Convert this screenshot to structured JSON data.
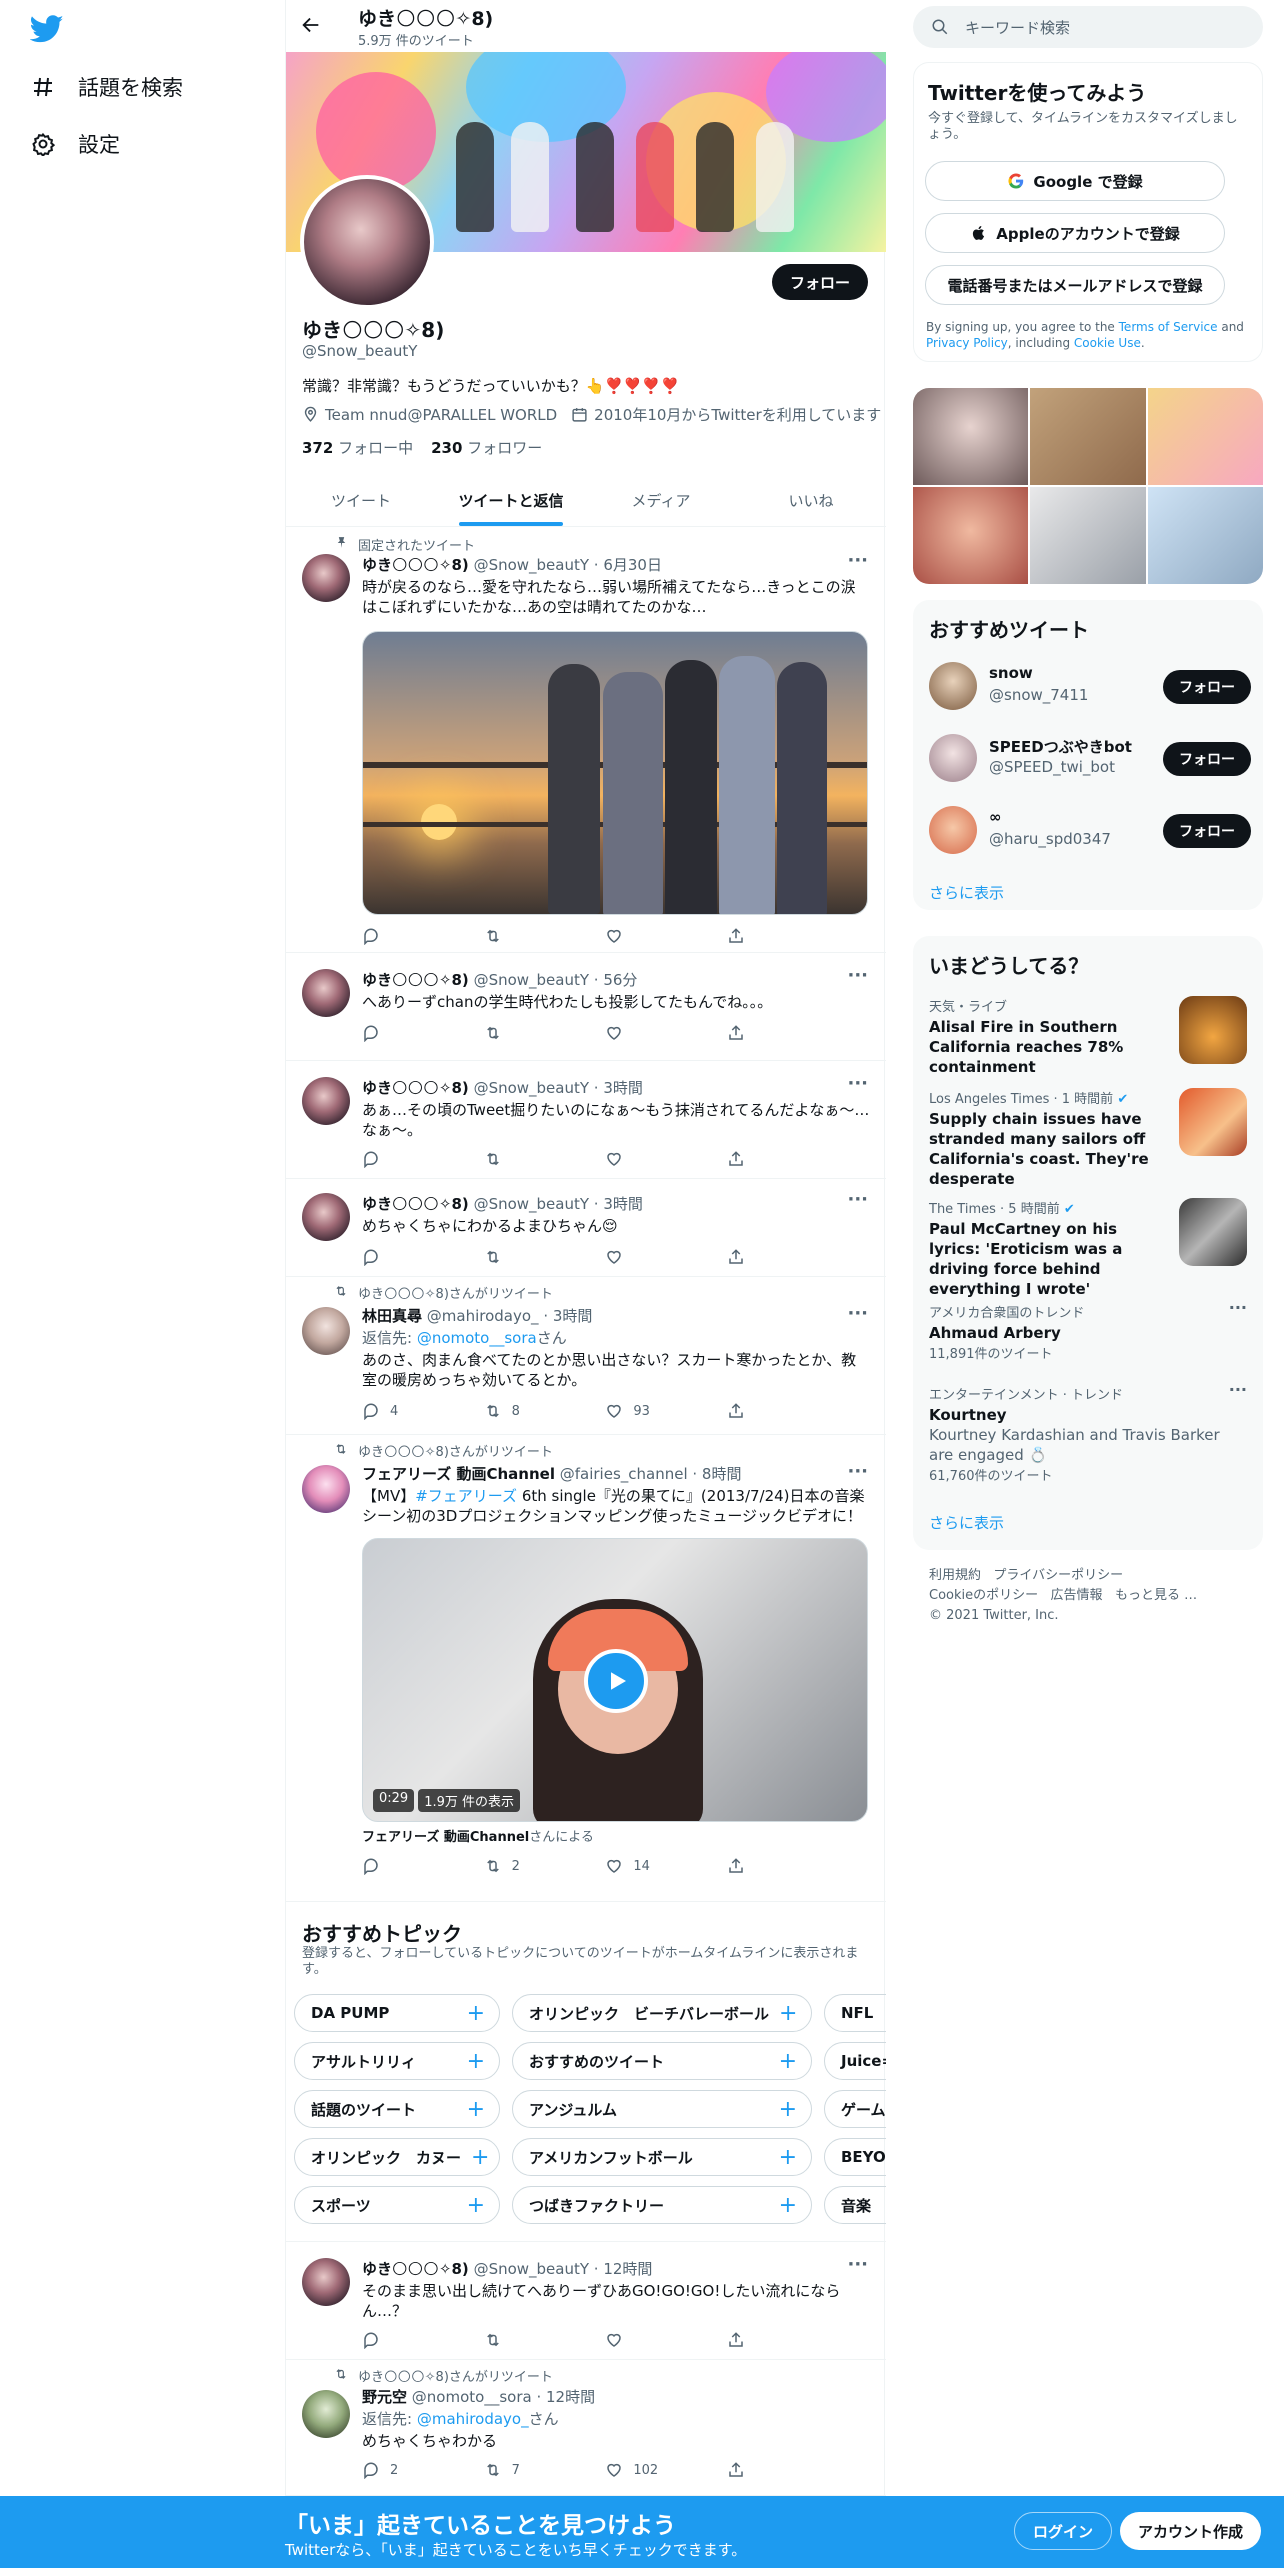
{
  "nav": {
    "explore_label": "話題を検索",
    "settings_label": "設定"
  },
  "profile": {
    "top_name": "ゆき🌕🌕🌕✧8)",
    "top_count": "5.9万 件のツイート",
    "name": "ゆき🌕🌕🌕✧8)",
    "handle": "@Snow_beautY",
    "follow_label": "フォロー",
    "bio": "常識？非常識？もうどうだっていいかも？👆❣️❣️❣️❣️",
    "location": "Team nnud@PARALLEL WORLD",
    "joined": "2010年10月からTwitterを利用しています",
    "following_count": "372",
    "following_label": "フォロー中",
    "followers_count": "230",
    "followers_label": "フォロワー"
  },
  "tabs": [
    "ツイート",
    "ツイートと返信",
    "メディア",
    "いいね"
  ],
  "tweets": [
    {
      "context": "固定されたツイート",
      "name": "ゆき🌕🌕🌕✧8)",
      "meta": "@Snow_beautY · 6月30日",
      "text": "時が戻るのなら…愛を守れたなら…弱い場所補えてたなら…きっとこの涙はこぼれずにいたかな…あの空は晴れてたのかな…"
    },
    {
      "name": "ゆき🌕🌕🌕✧8)",
      "meta": "@Snow_beautY · 56分",
      "text": "へありーずchanの学生時代わたしも投影してたもんでね。。。"
    },
    {
      "name": "ゆき🌕🌕🌕✧8)",
      "meta": "@Snow_beautY · 3時間",
      "text": "あぁ…その頃のTweet掘りたいのになぁ〜もう抹消されてるんだよなぁ〜…なぁ〜。"
    },
    {
      "name": "ゆき🌕🌕🌕✧8)",
      "meta": "@Snow_beautY · 3時間",
      "text": "めちゃくちゃにわかるよまひちゃん😌"
    },
    {
      "context": "ゆき🌕🌕🌕✧8)さんがリツイート",
      "name": "林田真尋",
      "meta": "@mahirodayo_ · 3時間",
      "reply_prefix": "返信先: ",
      "reply_to": "@nomoto__sora",
      "reply_suffix": "さん",
      "text": "あのさ、肉まん食べてたのとか思い出さない？スカート寒かったとか、教室の暖房めっちゃ効いてるとか。",
      "replies": "4",
      "retweets": "8",
      "likes": "93"
    },
    {
      "context": "ゆき🌕🌕🌕✧8)さんがリツイート",
      "name": "フェアリーズ 動画Channel",
      "meta": "@fairies_channel · 8時間",
      "text_prefix": "【MV】",
      "hashtag": "#フェアリーズ",
      "text": " 6th single『光の果てに』(2013/7/24)日本の音楽シーン初の3Dプロジェクションマッピング使ったミュージックビデオに！",
      "video_time": "0:29",
      "video_views": "1.9万 件の表示",
      "video_source_name": "フェアリーズ 動画Channel",
      "video_source_suffix": "さんによる",
      "replies": "",
      "retweets": "2",
      "likes": "14"
    },
    {
      "name": "ゆき🌕🌕🌕✧8)",
      "meta": "@Snow_beautY · 12時間",
      "text": "そのまま思い出し続けてへありーずひあGO!GO!GO!したい流れになら ん…？"
    },
    {
      "context": "ゆき🌕🌕🌕✧8)さんがリツイート",
      "name": "野元空",
      "meta": "@nomoto__sora · 12時間",
      "reply_prefix": "返信先: ",
      "reply_to": "@mahirodayo_",
      "reply_suffix": "さん",
      "text": "めちゃくちゃわかる",
      "replies": "2",
      "retweets": "7",
      "likes": "102"
    }
  ],
  "topics": {
    "title": "おすすめトピック",
    "subtitle": "登録すると、フォローしているトピックについてのツイートがホームタイムラインに表示されます。",
    "chips": [
      "DA PUMP",
      "オリンピック　ビーチバレーボール",
      "NFL",
      "アサルトリリィ",
      "おすすめのツイート",
      "Juice=",
      "話題のツイート",
      "アンジュルム",
      "ゲーム",
      "オリンピック　カヌー",
      "アメリカンフットボール",
      "BEYO",
      "スポーツ",
      "つばきファクトリー",
      "音楽"
    ]
  },
  "search": {
    "placeholder": "キーワード検索"
  },
  "signup": {
    "title": "Twitterを使ってみよう",
    "subtitle": "今すぐ登録して、タイムラインをカスタマイズしましょう。",
    "google": "Google で登録",
    "apple": "Appleのアカウントで登録",
    "phone": "電話番号またはメールアドレスで登録",
    "legal_prefix": "By signing up, you agree to the ",
    "terms": "Terms of Service",
    "and": " and ",
    "privacy": "Privacy Policy",
    "including": ", including ",
    "cookie": "Cookie Use",
    "period": "."
  },
  "recommended": {
    "title": "おすすめツイート",
    "users": [
      {
        "name": "snow",
        "handle": "@snow_7411",
        "follow": "フォロー"
      },
      {
        "name": "SPEEDつぶやきbot",
        "handle": "@SPEED_twi_bot",
        "follow": "フォロー"
      },
      {
        "name": "∞",
        "handle": "@haru_spd0347",
        "follow": "フォロー"
      }
    ],
    "more": "さらに表示"
  },
  "trends": {
    "title": "いまどうしてる？",
    "items": [
      {
        "meta": "天気・ライブ",
        "title": "Alisal Fire in Southern California reaches 78% containment"
      },
      {
        "meta": "Los Angeles Times · 1 時間前",
        "title": "Supply chain issues have stranded many sailors off California's coast. They're desperate"
      },
      {
        "meta": "The Times · 5 時間前",
        "title": "Paul McCartney on his lyrics: 'Eroticism was a driving force behind everything I wrote'"
      },
      {
        "meta": "アメリカ合衆国のトレンド",
        "title": "Ahmaud Arbery",
        "sub": "11,891件のツイート"
      },
      {
        "meta": "エンターテインメント · トレンド",
        "title": "Kourtney",
        "sub": "Kourtney Kardashian and Travis Barker are engaged 💍",
        "sub2": "61,760件のツイート"
      }
    ],
    "more": "さらに表示"
  },
  "footer": {
    "terms": "利用規約",
    "privacy": "プライバシーポリシー",
    "cookie": "Cookieのポリシー",
    "ads": "広告情報",
    "more": "もっと見る …",
    "copyright": "© 2021 Twitter, Inc."
  },
  "bottom": {
    "title": "「いま」起きていることを見つけよう",
    "subtitle": "Twitterなら、「いま」起きていることをいち早くチェックできます。",
    "login": "ログイン",
    "signup": "アカウント作成"
  }
}
